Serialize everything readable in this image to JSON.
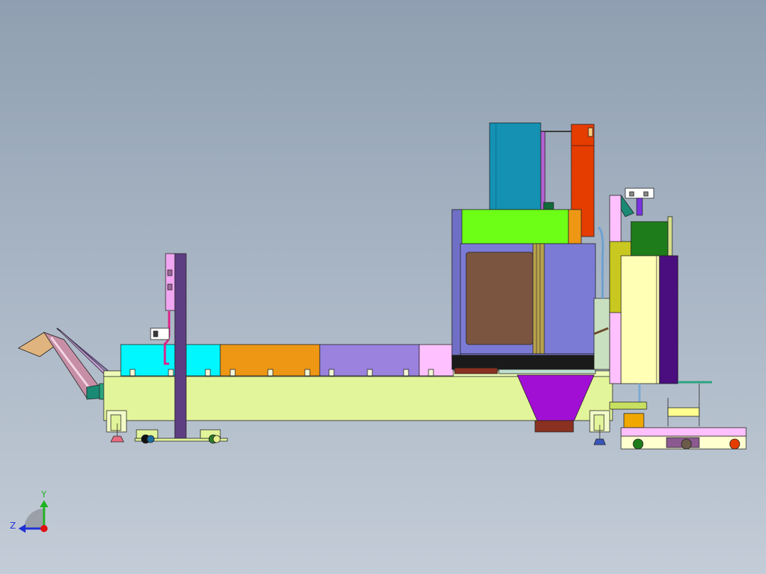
{
  "view": {
    "type": "cad-assembly-side-view"
  },
  "triad": {
    "y_label": "Y",
    "z_label": "Z",
    "y_color": "#1fb31f",
    "z_color": "#1f2fd6",
    "origin_color": "#e01010"
  },
  "palette": {
    "bed": "#e3f59a",
    "bin_cyan": "#00f7ff",
    "bin_orange": "#ee9714",
    "bin_purple": "#9a82de",
    "bin_pink": "#ffc0ff",
    "cabinet_teal": "#1491b3",
    "column_orange": "#e53c00",
    "lime": "#6dff16",
    "body_blue": "#7b7bd6",
    "window_brown": "#7b5540",
    "hopper_magenta": "#a20fd4",
    "cabinet_cream": "#ffffb5",
    "cabinet_violet": "#4a0e7e",
    "dark_green": "#1e7d1a",
    "mast_violet": "#5e3e82"
  }
}
